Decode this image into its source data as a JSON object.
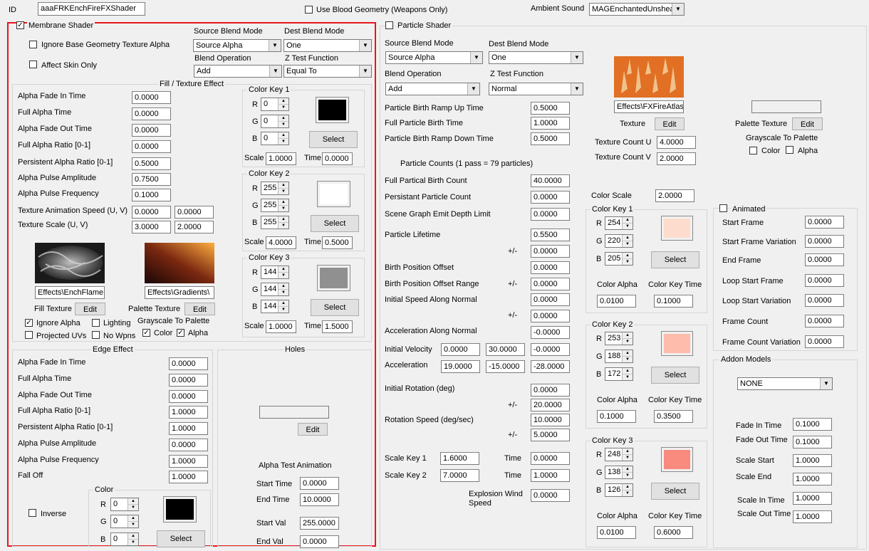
{
  "top": {
    "id_label": "ID",
    "id_value": "aaaFRKEnchFireFXShader",
    "blood_label": "Use Blood Geometry (Weapons Only)",
    "ambient_label": "Ambient Sound",
    "ambient_value": "MAGEnchantedUnsheat"
  },
  "membrane": {
    "title": "Membrane Shader",
    "checked": true,
    "ignore_alpha": "Ignore Base Geometry Texture Alpha",
    "affect_skin": "Affect Skin Only",
    "src_blend_label": "Source Blend Mode",
    "src_blend": "Source Alpha",
    "dest_blend_label": "Dest Blend Mode",
    "dest_blend": "One",
    "blend_op_label": "Blend Operation",
    "blend_op": "Add",
    "ztest_label": "Z Test Function",
    "ztest": "Equal To",
    "fill": {
      "title": "Fill / Texture Effect",
      "rows": [
        {
          "label": "Alpha Fade In Time",
          "value": "0.0000"
        },
        {
          "label": "Full Alpha Time",
          "value": "0.0000"
        },
        {
          "label": "Alpha Fade Out Time",
          "value": "0.0000"
        },
        {
          "label": "Full Alpha Ratio [0-1]",
          "value": "0.0000"
        },
        {
          "label": "Persistent Alpha Ratio [0-1]",
          "value": "0.5000"
        },
        {
          "label": "Alpha Pulse Amplitude",
          "value": "0.7500"
        },
        {
          "label": "Alpha Pulse Frequency",
          "value": "0.1000"
        }
      ],
      "anim_speed_label": "Texture Animation Speed (U, V)",
      "anim_u": "0.0000",
      "anim_v": "0.0000",
      "scale_label": "Texture Scale (U, V)",
      "scale_u": "3.0000",
      "scale_v": "2.0000",
      "fill_tex_path": "Effects\\EnchFlameI",
      "pal_tex_path": "Effects\\Gradients\\",
      "fill_tex_label": "Fill Texture",
      "pal_tex_label": "Palette Texture",
      "edit": "Edit",
      "ignore_alpha": "Ignore Alpha",
      "lighting": "Lighting",
      "projected": "Projected UVs",
      "no_wpns": "No Wpns",
      "gray_label": "Grayscale To Palette",
      "gray_color": "Color",
      "gray_alpha": "Alpha"
    },
    "color_keys": [
      {
        "title": "Color Key 1",
        "r": "0",
        "g": "0",
        "b": "0",
        "color": "#000000",
        "scale": "1.0000",
        "time": "0.0000"
      },
      {
        "title": "Color Key 2",
        "r": "255",
        "g": "255",
        "b": "255",
        "color": "#ffffff",
        "scale": "4.0000",
        "time": "0.5000"
      },
      {
        "title": "Color Key 3",
        "r": "144",
        "g": "144",
        "b": "144",
        "color": "#909090",
        "scale": "1.0000",
        "time": "1.5000"
      }
    ],
    "edge": {
      "title": "Edge Effect",
      "rows": [
        {
          "label": "Alpha Fade In Time",
          "value": "0.0000"
        },
        {
          "label": "Full Alpha Time",
          "value": "0.0000"
        },
        {
          "label": "Alpha Fade Out Time",
          "value": "0.0000"
        },
        {
          "label": "Full Alpha Ratio [0-1]",
          "value": "1.0000"
        },
        {
          "label": "Persistent Alpha Ratio [0-1]",
          "value": "1.0000"
        },
        {
          "label": "Alpha Pulse Amplitude",
          "value": "0.0000"
        },
        {
          "label": "Alpha Pulse Frequency",
          "value": "1.0000"
        },
        {
          "label": "Fall Off",
          "value": "1.0000"
        }
      ],
      "inverse": "Inverse",
      "color_title": "Color",
      "r": "0",
      "g": "0",
      "b": "0",
      "color": "#000000"
    },
    "holes": {
      "title": "Holes",
      "edit": "Edit",
      "anim_title": "Alpha Test Animation",
      "start_time_label": "Start Time",
      "start_time": "0.0000",
      "end_time_label": "End Time",
      "end_time": "10.0000",
      "start_val_label": "Start Val",
      "start_val": "255.0000",
      "end_val_label": "End Val",
      "end_val": "0.0000"
    }
  },
  "common": {
    "r": "R",
    "g": "G",
    "b": "B",
    "select": "Select",
    "scale": "Scale",
    "time": "Time"
  },
  "particle": {
    "title": "Particle Shader",
    "src_blend_label": "Source Blend Mode",
    "src_blend": "Source Alpha",
    "dest_blend_label": "Dest Blend Mode",
    "dest_blend": "One",
    "blend_op_label": "Blend Operation",
    "blend_op": "Add",
    "ztest_label": "Z Test Function",
    "ztest": "Normal",
    "birth": [
      {
        "label": "Particle Birth Ramp Up Time",
        "value": "0.5000"
      },
      {
        "label": "Full Particle Birth Time",
        "value": "1.0000"
      },
      {
        "label": "Particle Birth Ramp Down Time",
        "value": "0.5000"
      }
    ],
    "counts_label": "Particle Counts (1 pass = 79 particles)",
    "count_rows": [
      {
        "label": "Full Partical Birth Count",
        "value": "40.0000"
      },
      {
        "label": "Persistant Particle Count",
        "value": "0.0000"
      },
      {
        "label": "Scene Graph Emit Depth Limit",
        "value": "0.0000"
      },
      {
        "label": "Particle Lifetime",
        "value": "0.5500"
      }
    ],
    "pm": "+/-",
    "lifetime_pm": "0.0000",
    "birth_pos_label": "Birth Position Offset",
    "birth_pos": "0.0000",
    "birth_pos_range_label": "Birth Position Offset Range",
    "birth_pos_range": "0.0000",
    "init_speed_label": "Initial Speed Along Normal",
    "init_speed": "0.0000",
    "init_speed_pm": "0.0000",
    "accel_normal_label": "Acceleration Along Normal",
    "accel_normal": "-0.0000",
    "init_vel_label": "Initial Velocity",
    "init_vel": [
      "0.0000",
      "30.0000",
      "-0.0000"
    ],
    "accel_label": "Acceleration",
    "accel": [
      "19.0000",
      "-15.0000",
      "-28.0000"
    ],
    "init_rot_label": "Initial Rotation (deg)",
    "init_rot": "0.0000",
    "init_rot_pm": "20.0000",
    "rot_speed_label": "Rotation Speed (deg/sec)",
    "rot_speed": "10.0000",
    "rot_speed_pm": "5.0000",
    "scale_key1_label": "Scale Key 1",
    "scale_key1": "1.6000",
    "scale_key1_time": "0.0000",
    "scale_key2_label": "Scale Key 2",
    "scale_key2": "7.0000",
    "scale_key2_time": "1.0000",
    "explosion_label1": "Explosion Wind",
    "explosion_label2": "Speed",
    "explosion": "0.0000",
    "tex_path": "Effects\\FXFireAtlas",
    "tex_label": "Texture",
    "edit": "Edit",
    "count_u_label": "Texture Count U",
    "count_u": "4.0000",
    "count_v_label": "Texture Count V",
    "count_v": "2.0000",
    "pal_tex_label": "Palette Texture",
    "gray_label": "Grayscale To Palette",
    "gray_color": "Color",
    "gray_alpha": "Alpha",
    "color_scale_label": "Color Scale",
    "color_scale": "2.0000",
    "alpha_label": "Color Alpha",
    "keytime_label": "Color Key Time",
    "color_keys": [
      {
        "title": "Color Key 1",
        "r": "254",
        "g": "220",
        "b": "205",
        "color": "#fedccd",
        "alpha": "0.0100",
        "time": "0.1000"
      },
      {
        "title": "Color Key 2",
        "r": "253",
        "g": "188",
        "b": "172",
        "color": "#fdbcac",
        "alpha": "0.1000",
        "time": "0.3500"
      },
      {
        "title": "Color Key 3",
        "r": "248",
        "g": "138",
        "b": "126",
        "color": "#f88a7e",
        "alpha": "0.0100",
        "time": "0.6000"
      }
    ],
    "animated": {
      "title": "Animated",
      "rows": [
        {
          "label": "Start Frame",
          "value": "0.0000"
        },
        {
          "label": "Start Frame Variation",
          "value": "0.0000"
        },
        {
          "label": "End Frame",
          "value": "0.0000"
        },
        {
          "label": "Loop Start Frame",
          "value": "0.0000"
        },
        {
          "label": "Loop Start Variation",
          "value": "0.0000"
        },
        {
          "label": "Frame Count",
          "value": "0.0000"
        },
        {
          "label": "Frame Count Variation",
          "value": "0.0000"
        }
      ]
    },
    "addon": {
      "title": "Addon Models",
      "model": "NONE",
      "rows": [
        {
          "label": "Fade In Time",
          "value": "0.1000"
        },
        {
          "label": "Fade Out Time",
          "value": "0.1000"
        },
        {
          "label": "Scale Start",
          "value": "1.0000"
        },
        {
          "label": "Scale End",
          "value": "1.0000"
        },
        {
          "label": "Scale In Time",
          "value": "1.0000"
        },
        {
          "label": "Scale Out Time",
          "value": "1.0000"
        }
      ]
    }
  }
}
